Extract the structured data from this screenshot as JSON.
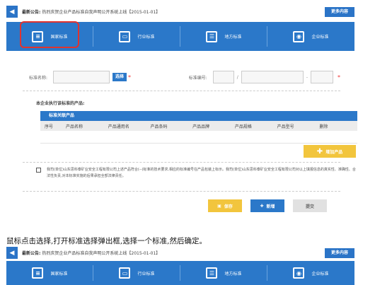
{
  "announcement": {
    "label": "最新公告:",
    "text": "热烈庆贺企业产品标准自我声明公开系统上线【2015-01-01】",
    "more": "更多内容"
  },
  "tabs": [
    {
      "label": "国家标准",
      "icon": "document-icon"
    },
    {
      "label": "行业标准",
      "icon": "briefcase-icon"
    },
    {
      "label": "地方标准",
      "icon": "document-list-icon"
    },
    {
      "label": "企业标准",
      "icon": "user-search-icon"
    }
  ],
  "form": {
    "std_name_label": "标准名称:",
    "select_btn": "选择",
    "std_no_label": "标准编号:",
    "sep_slash": "/",
    "sep_dash": "-",
    "required_mark": "*",
    "section_title": "本企业执行该标准的产品:",
    "table_title": "标准关联产品",
    "columns": [
      "序号",
      "产品名称",
      "产品通用名",
      "产品条码",
      "产品品牌",
      "产品规格",
      "产品型号",
      "删除"
    ],
    "add_product": "增加产品",
    "agree_text": "我司(单位)山东思科泰矿业安全工程有限公司上述产品符合(--)标准的技术要求,相应的标准编号在产品包装上标示。我司(单位)山东思科泰矿业安全工程有限公司对以上填报信息的真实性、准确性、合法性负责,对本标准实施的后果承担全部法律责任。",
    "save": "保存",
    "new": "新增",
    "submit": "提交"
  },
  "instruction": "鼠标点击选择,打开标准选择弹出框,选择一个标准,然后确定。"
}
